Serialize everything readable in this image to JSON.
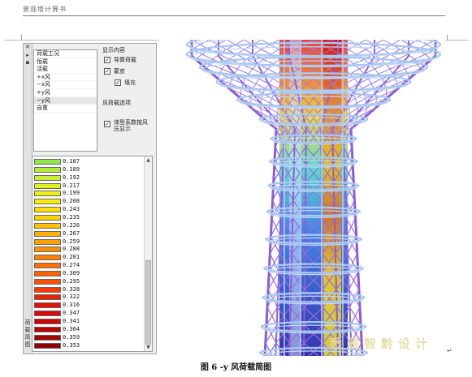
{
  "doc": {
    "header": "景观塔计算书",
    "caption": "图 6 -y 风荷载简图",
    "watermark": "悉雅智黔设计"
  },
  "panel": {
    "strip_chars": [
      "荷",
      "载",
      "简",
      "图"
    ],
    "load_list_title": "荷载工况",
    "load_cases": [
      "恒载",
      "活载",
      "+x风",
      "−x风",
      "+y风",
      "−y风",
      "自重"
    ],
    "selected_case": "−y风",
    "display_group_title": "显示内容",
    "checks": [
      {
        "label": "导算荷载",
        "checked": true
      },
      {
        "label": "蒙皮",
        "checked": true
      },
      {
        "label": "填充",
        "checked": true
      }
    ],
    "wind_group_title": "风荷载选项",
    "wind_check": {
      "label": "体型系数按风压显示",
      "checked": true
    }
  },
  "legend": [
    {
      "value": "0.187",
      "color": "#8eea48"
    },
    {
      "value": "0.189",
      "color": "#b0ee3c"
    },
    {
      "value": "0.192",
      "color": "#c8f030"
    },
    {
      "value": "0.217",
      "color": "#e0f020"
    },
    {
      "value": "0.199",
      "color": "#f0f014"
    },
    {
      "value": "0.208",
      "color": "#f8ec08"
    },
    {
      "value": "0.243",
      "color": "#ffe000"
    },
    {
      "value": "0.235",
      "color": "#ffd000"
    },
    {
      "value": "0.226",
      "color": "#ffc000"
    },
    {
      "value": "0.267",
      "color": "#ffb000"
    },
    {
      "value": "0.259",
      "color": "#ffa000"
    },
    {
      "value": "0.288",
      "color": "#ff9000"
    },
    {
      "value": "0.281",
      "color": "#ff8000"
    },
    {
      "value": "0.274",
      "color": "#ff7000"
    },
    {
      "value": "0.309",
      "color": "#ff6000"
    },
    {
      "value": "0.295",
      "color": "#ff5000"
    },
    {
      "value": "0.328",
      "color": "#ff3800"
    },
    {
      "value": "0.322",
      "color": "#f02000"
    },
    {
      "value": "0.316",
      "color": "#e81000"
    },
    {
      "value": "0.347",
      "color": "#dc0808"
    },
    {
      "value": "0.341",
      "color": "#cc0404"
    },
    {
      "value": "0.364",
      "color": "#b80000"
    },
    {
      "value": "0.359",
      "color": "#a40000"
    },
    {
      "value": "0.353",
      "color": "#900000"
    }
  ]
}
